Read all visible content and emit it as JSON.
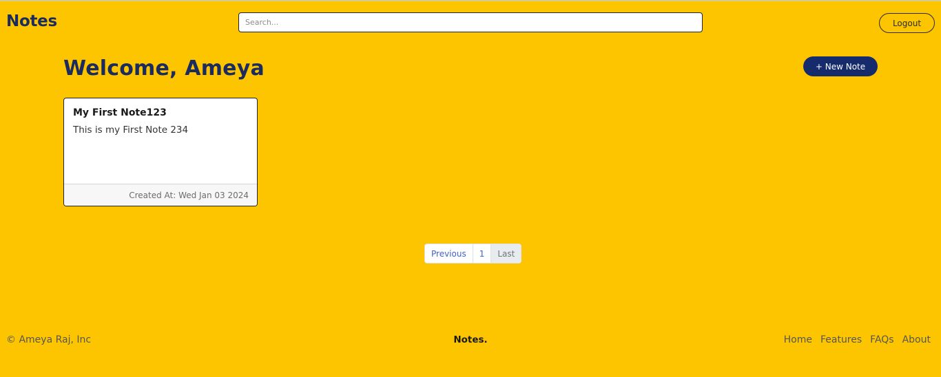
{
  "header": {
    "brand": "Notes",
    "search_placeholder": "Search...",
    "logout_label": "Logout"
  },
  "main": {
    "welcome": "Welcome, Ameya",
    "new_note_label": "+ New Note",
    "notes": [
      {
        "title": "My First Note123",
        "body": "This is my First Note 234",
        "created": "Created At: Wed Jan 03 2024"
      }
    ]
  },
  "pagination": {
    "previous": "Previous",
    "page": "1",
    "last": "Last"
  },
  "footer": {
    "copyright": "© Ameya Raj, Inc",
    "brand": "Notes.",
    "links": [
      "Home",
      "Features",
      "FAQs",
      "About"
    ]
  },
  "colors": {
    "background": "#fdc500",
    "primary": "#152b6b",
    "brand_text": "#1c2b5e"
  }
}
